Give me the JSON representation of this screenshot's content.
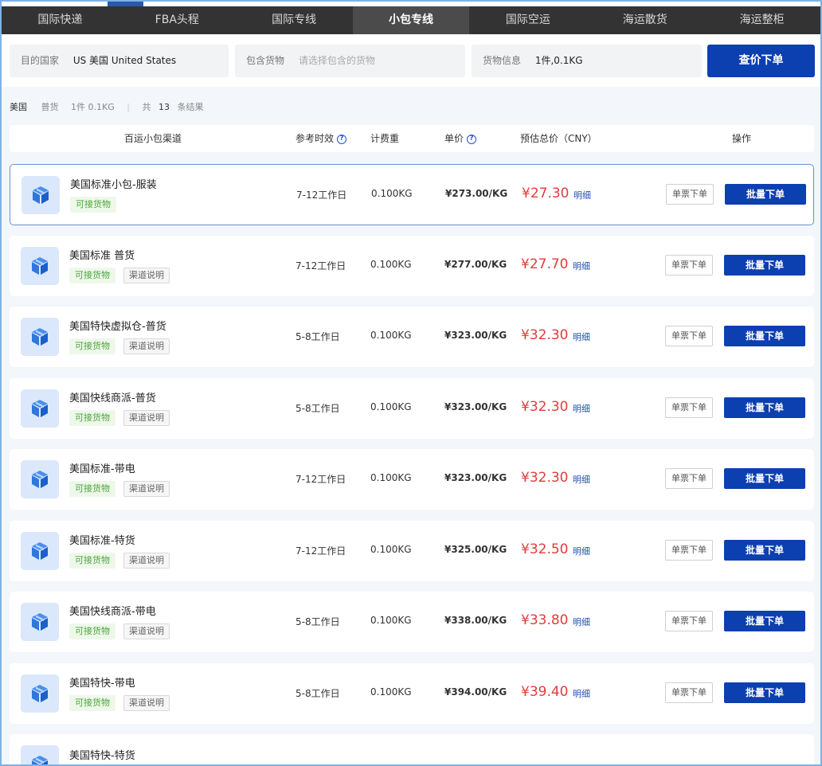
{
  "nav": {
    "tabs": [
      {
        "label": "国际快递",
        "active": false
      },
      {
        "label": "FBA头程",
        "active": false
      },
      {
        "label": "国际专线",
        "active": false
      },
      {
        "label": "小包专线",
        "active": true
      },
      {
        "label": "国际空运",
        "active": false
      },
      {
        "label": "海运散货",
        "active": false
      },
      {
        "label": "海运整柜",
        "active": false
      }
    ]
  },
  "filters": {
    "destination": {
      "label": "目的国家",
      "value": "US 美国 United States"
    },
    "goods": {
      "label": "包含货物",
      "placeholder": "请选择包含的货物"
    },
    "cargo_info": {
      "label": "货物信息",
      "value": "1件,0.1KG"
    },
    "query_button": "查价下单"
  },
  "summary": {
    "country": "美国",
    "goods": "普货",
    "qty_weight": "1件  0.1KG",
    "total_prefix": "共",
    "total_count": "13",
    "total_suffix": "条结果"
  },
  "table": {
    "headers": {
      "channel": "百运小包渠道",
      "timeliness": "参考时效",
      "weight": "计费重",
      "unit_price": "单价",
      "total": "预估总价（CNY）",
      "action": "操作"
    },
    "rows": [
      {
        "name": "美国标准小包-服装",
        "tag": "可接货物",
        "desc": "",
        "time": "7-12工作日",
        "weight": "0.100KG",
        "unit": "¥273.00/KG",
        "price": "¥27.30",
        "detail": "明细",
        "single": "单票下单",
        "bulk": "批量下单"
      },
      {
        "name": "美国标准 普货",
        "tag": "可接货物",
        "desc": "渠道说明",
        "time": "7-12工作日",
        "weight": "0.100KG",
        "unit": "¥277.00/KG",
        "price": "¥27.70",
        "detail": "明细",
        "single": "单票下单",
        "bulk": "批量下单"
      },
      {
        "name": "美国特快虚拟仓-普货",
        "tag": "可接货物",
        "desc": "渠道说明",
        "time": "5-8工作日",
        "weight": "0.100KG",
        "unit": "¥323.00/KG",
        "price": "¥32.30",
        "detail": "明细",
        "single": "单票下单",
        "bulk": "批量下单"
      },
      {
        "name": "美国快线商派-普货",
        "tag": "可接货物",
        "desc": "渠道说明",
        "time": "5-8工作日",
        "weight": "0.100KG",
        "unit": "¥323.00/KG",
        "price": "¥32.30",
        "detail": "明细",
        "single": "单票下单",
        "bulk": "批量下单"
      },
      {
        "name": "美国标准-带电",
        "tag": "可接货物",
        "desc": "渠道说明",
        "time": "7-12工作日",
        "weight": "0.100KG",
        "unit": "¥323.00/KG",
        "price": "¥32.30",
        "detail": "明细",
        "single": "单票下单",
        "bulk": "批量下单"
      },
      {
        "name": "美国标准-特货",
        "tag": "可接货物",
        "desc": "渠道说明",
        "time": "7-12工作日",
        "weight": "0.100KG",
        "unit": "¥325.00/KG",
        "price": "¥32.50",
        "detail": "明细",
        "single": "单票下单",
        "bulk": "批量下单"
      },
      {
        "name": "美国快线商派-带电",
        "tag": "可接货物",
        "desc": "渠道说明",
        "time": "5-8工作日",
        "weight": "0.100KG",
        "unit": "¥338.00/KG",
        "price": "¥33.80",
        "detail": "明细",
        "single": "单票下单",
        "bulk": "批量下单"
      },
      {
        "name": "美国特快-带电",
        "tag": "可接货物",
        "desc": "渠道说明",
        "time": "5-8工作日",
        "weight": "0.100KG",
        "unit": "¥394.00/KG",
        "price": "¥39.40",
        "detail": "明细",
        "single": "单票下单",
        "bulk": "批量下单"
      },
      {
        "name": "美国特快-特货",
        "tag": "",
        "desc": "",
        "time": "",
        "weight": "",
        "unit": "",
        "price": "",
        "detail": "",
        "single": "",
        "bulk": ""
      }
    ]
  }
}
